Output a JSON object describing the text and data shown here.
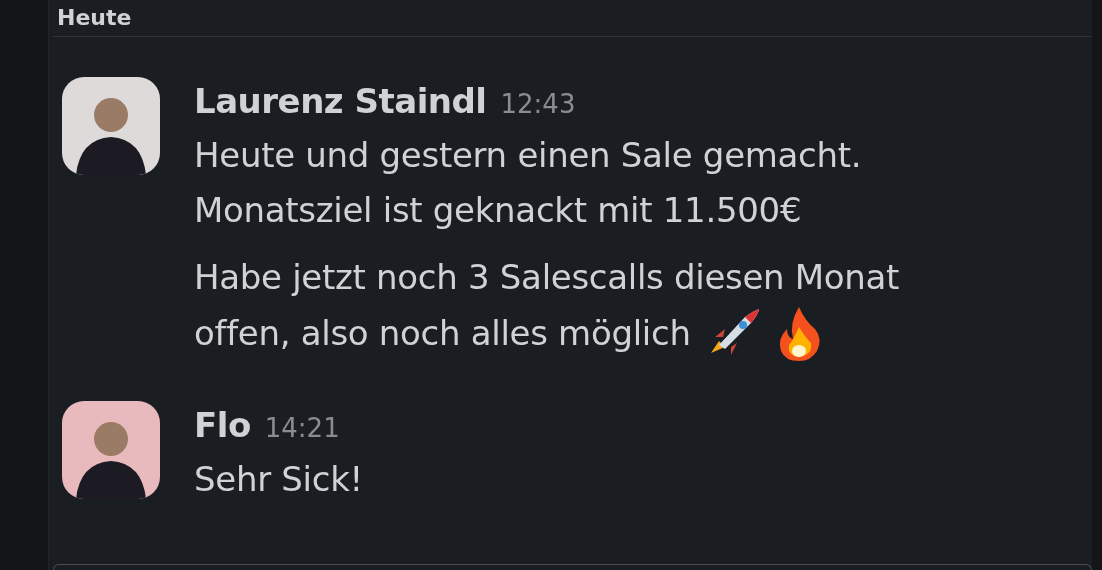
{
  "day_header": "Heute",
  "messages": [
    {
      "author": "Laurenz Staindl",
      "time": "12:43",
      "color": "#dedad9",
      "paragraphs": [
        {
          "lines": [
            "Heute und gestern einen Sale gemacht.",
            "Monatsziel ist geknackt mit 11.500€"
          ]
        },
        {
          "lines": [
            "Habe jetzt noch 3 Salescalls diesen Monat",
            "offen, also noch alles möglich"
          ],
          "emoji": [
            {
              "kind": "rocket"
            },
            {
              "kind": "fire"
            }
          ]
        }
      ]
    },
    {
      "author": "Flo",
      "time": "14:21",
      "color": "#e8b9bd",
      "paragraphs": [
        {
          "lines": [
            "Sehr Sick!"
          ]
        }
      ]
    }
  ]
}
